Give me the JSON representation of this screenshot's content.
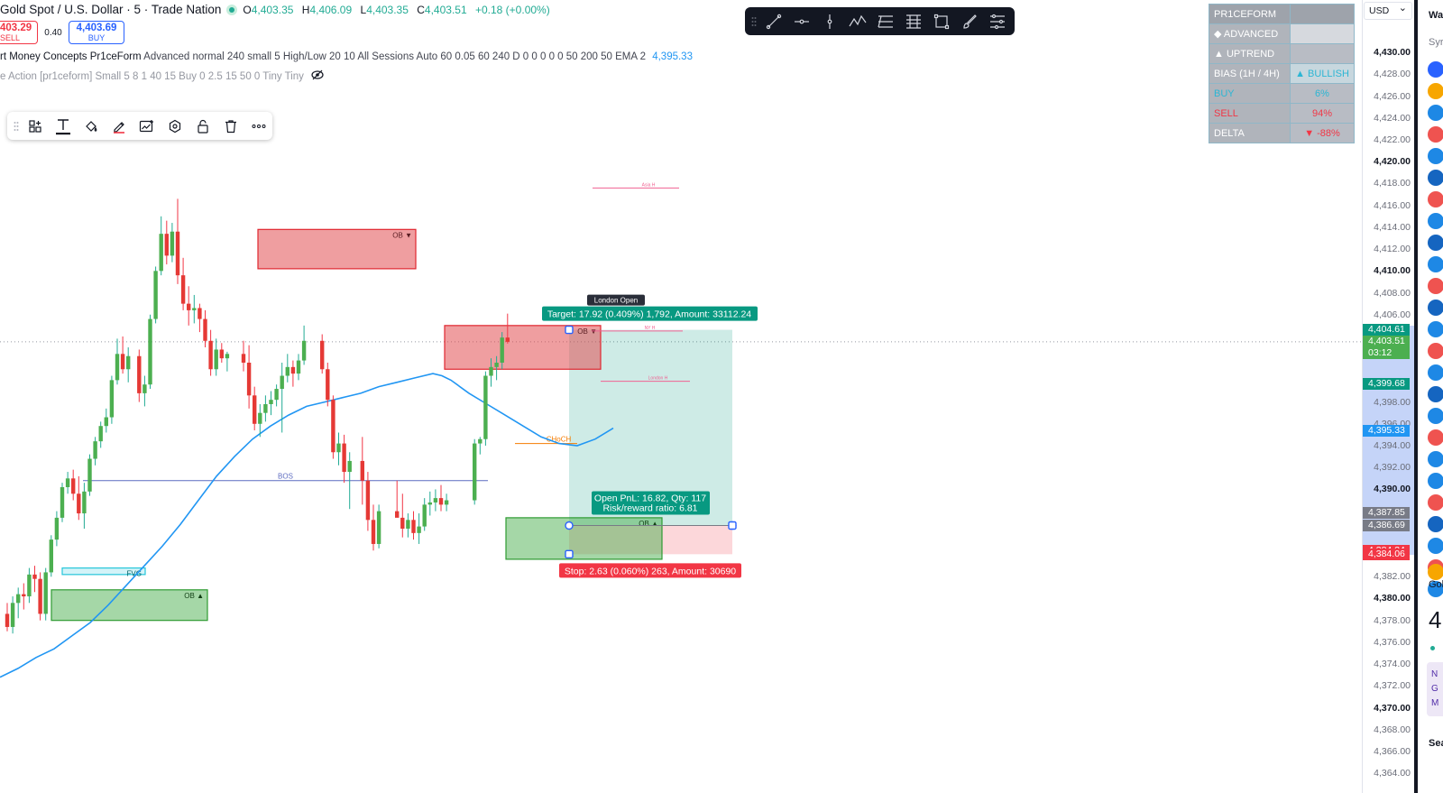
{
  "header": {
    "symbol_title": "Gold Spot / U.S. Dollar · 5 · Trade Nation",
    "ohlc": {
      "o_label": "O",
      "o": "4,403.35",
      "h_label": "H",
      "h": "4,406.09",
      "l_label": "L",
      "l": "4,403.35",
      "c_label": "C",
      "c": "4,403.51",
      "change": "+0.18 (+0.00%)"
    },
    "sell_price": "403.29",
    "sell_label": "SELL",
    "spread": "0.40",
    "buy_price": "4,403.69",
    "buy_label": "BUY"
  },
  "indicators": {
    "smc_name": "rt Money Concepts Pr1ceForm",
    "smc_params": "Advanced normal 240 small 5 High/Low 20 10 All Sessions Auto 60 0.05 60 240 D 0 0 0 0 0 50 200 50 EMA 2",
    "smc_value": "4,395.33",
    "pa_text": "e Action [pr1ceform] Small 5 8 1 40 15 Buy 0 2.5 15 50 0 Tiny Tiny"
  },
  "toolbars": {
    "drawing_toolbar_icons": [
      "grip-icon",
      "layout-icon",
      "text-tool-icon",
      "paint-bucket-icon",
      "pen-color-icon",
      "add-chart-icon",
      "settings-hex-icon",
      "lock-icon",
      "trash-icon",
      "more-icon"
    ],
    "top_toolbar_icons": [
      "grip-icon",
      "trendline-icon",
      "horizontal-ray-icon",
      "vertical-line-icon",
      "pattern-icon",
      "fib-retracement-icon",
      "fib-channel-icon",
      "rectangle-icon",
      "brush-icon",
      "more-lines-icon"
    ]
  },
  "smc_table": {
    "rows": [
      {
        "key": "PR1CEFORM",
        "value": "",
        "key_color": "#ffffff",
        "value_color": "#ffffff",
        "key_bg": "#9ea3ab",
        "value_bg": "#9ea3ab"
      },
      {
        "key": "◆ ADVANCED",
        "value": "",
        "key_color": "#ffffff",
        "value_color": "#ffffff",
        "key_bg": "#b0b4bb",
        "value_bg": "#d6d9de"
      },
      {
        "key": "▲ UPTREND",
        "value": "",
        "key_color": "#ffffff",
        "value_color": "#ffffff",
        "key_bg": "#b0b4bb",
        "value_bg": "#b8bcc4"
      },
      {
        "key": "BIAS  (1H / 4H)",
        "value": "▲ BULLISH",
        "key_color": "#ffffff",
        "value_color": "#2cb6d4",
        "key_bg": "#b0b4bb",
        "value_bg": "#c7d7de"
      },
      {
        "key": "BUY",
        "value": "6%",
        "key_color": "#2cb6d4",
        "value_color": "#2cb6d4",
        "key_bg": "#b0b4bb",
        "value_bg": "#b8bcc4"
      },
      {
        "key": "SELL",
        "value": "94%",
        "key_color": "#f23645",
        "value_color": "#f23645",
        "key_bg": "#b0b4bb",
        "value_bg": "#b8bcc4"
      },
      {
        "key": "DELTA",
        "value": "▼ -88%",
        "key_color": "#ffffff",
        "value_color": "#f23645",
        "key_bg": "#b0b4bb",
        "value_bg": "#b8bcc4"
      }
    ]
  },
  "price_axis": {
    "currency": "USD",
    "ticks": [
      {
        "label": "4,430.00",
        "y": 4430,
        "bold": true
      },
      {
        "label": "4,428.00",
        "y": 4428
      },
      {
        "label": "4,426.00",
        "y": 4426
      },
      {
        "label": "4,424.00",
        "y": 4424
      },
      {
        "label": "4,422.00",
        "y": 4422
      },
      {
        "label": "4,420.00",
        "y": 4420,
        "bold": true
      },
      {
        "label": "4,418.00",
        "y": 4418
      },
      {
        "label": "4,416.00",
        "y": 4416
      },
      {
        "label": "4,414.00",
        "y": 4414
      },
      {
        "label": "4,412.00",
        "y": 4412
      },
      {
        "label": "4,410.00",
        "y": 4410,
        "bold": true
      },
      {
        "label": "4,408.00",
        "y": 4408
      },
      {
        "label": "4,406.00",
        "y": 4406
      },
      {
        "label": "4,398.00",
        "y": 4398
      },
      {
        "label": "4,396.00",
        "y": 4396
      },
      {
        "label": "4,394.00",
        "y": 4394
      },
      {
        "label": "4,392.00",
        "y": 4392
      },
      {
        "label": "4,390.00",
        "y": 4390,
        "bold": true
      },
      {
        "label": "4,382.00",
        "y": 4382
      },
      {
        "label": "4,380.00",
        "y": 4380,
        "bold": true
      },
      {
        "label": "4,378.00",
        "y": 4378
      },
      {
        "label": "4,376.00",
        "y": 4376
      },
      {
        "label": "4,374.00",
        "y": 4374
      },
      {
        "label": "4,372.00",
        "y": 4372
      },
      {
        "label": "4,370.00",
        "y": 4370,
        "bold": true
      },
      {
        "label": "4,368.00",
        "y": 4368
      },
      {
        "label": "4,366.00",
        "y": 4366
      },
      {
        "label": "4,364.00",
        "y": 4364
      }
    ],
    "tags": [
      {
        "label": "4,404.61",
        "y": 4404.61,
        "color": "#089981"
      },
      {
        "label": "4,403.51",
        "y": 4403.51,
        "color": "#4caf50",
        "sub": "03:12"
      },
      {
        "label": "4,399.68",
        "y": 4399.68,
        "color": "#089981"
      },
      {
        "label": "4,395.33",
        "y": 4395.33,
        "color": "#2196f3"
      },
      {
        "label": "4,387.85",
        "y": 4387.85,
        "color": "#787b86"
      },
      {
        "label": "4,386.69",
        "y": 4386.69,
        "color": "#787b86"
      },
      {
        "label": "4,384.34",
        "y": 4384.34,
        "color": "#f23645"
      },
      {
        "label": "4,384.06",
        "y": 4384.06,
        "color": "#f23645"
      }
    ],
    "highlight_range": [
      4384,
      4405
    ]
  },
  "chart_data": {
    "type": "candlestick",
    "ylim": [
      4363.6,
      4432.0
    ],
    "x_index_range": [
      0,
      195
    ],
    "candles": [
      [
        4378.6,
        4379.6,
        4377.0,
        4377.4
      ],
      [
        4377.4,
        4380.2,
        4376.8,
        4379.6
      ],
      [
        4379.6,
        4381.0,
        4378.2,
        4380.4
      ],
      [
        4380.4,
        4381.4,
        4379.0,
        4380.2
      ],
      [
        4380.2,
        4382.8,
        4379.6,
        4382.2
      ],
      [
        4382.2,
        4383.0,
        4380.6,
        4381.8
      ],
      [
        4381.8,
        4382.4,
        4378.0,
        4378.6
      ],
      [
        4378.6,
        4382.8,
        4378.0,
        4382.4
      ],
      [
        4382.4,
        4385.8,
        4382.0,
        4385.4
      ],
      [
        4385.4,
        4388.0,
        4384.8,
        4387.4
      ],
      [
        4387.4,
        4390.6,
        4387.0,
        4390.2
      ],
      [
        4390.2,
        4391.6,
        4389.6,
        4391.0
      ],
      [
        4391.0,
        4391.8,
        4389.0,
        4389.6
      ],
      [
        4389.6,
        4391.2,
        4387.2,
        4387.8
      ],
      [
        4387.8,
        4390.6,
        4386.4,
        4389.8
      ],
      [
        4389.8,
        4393.2,
        4389.4,
        4392.8
      ],
      [
        4392.8,
        4394.8,
        4392.2,
        4394.4
      ],
      [
        4394.4,
        4396.2,
        4393.8,
        4395.8
      ],
      [
        4395.8,
        4397.4,
        4395.2,
        4396.6
      ],
      [
        4396.6,
        4400.4,
        4396.0,
        4400.0
      ],
      [
        4400.0,
        4403.8,
        4399.6,
        4402.4
      ],
      [
        4402.4,
        4404.0,
        4400.6,
        4401.0
      ],
      [
        4401.0,
        4403.0,
        4399.8,
        4402.2
      ],
      [
        4402.2,
        4402.8,
        4398.0,
        4398.8
      ],
      [
        4398.8,
        4400.4,
        4397.6,
        4399.6
      ],
      [
        4399.6,
        4406.0,
        4399.2,
        4405.6
      ],
      [
        4405.6,
        4410.4,
        4405.2,
        4410.0
      ],
      [
        4410.0,
        4415.0,
        4409.6,
        4413.4
      ],
      [
        4413.4,
        4414.6,
        4410.6,
        4411.4
      ],
      [
        4411.4,
        4414.4,
        4410.8,
        4413.6
      ],
      [
        4413.6,
        4416.6,
        4408.8,
        4409.6
      ],
      [
        4409.6,
        4411.2,
        4406.4,
        4407.0
      ],
      [
        4407.0,
        4408.6,
        4405.0,
        4406.4
      ],
      [
        4406.4,
        4407.8,
        4405.2,
        4406.6
      ],
      [
        4406.6,
        4407.0,
        4404.4,
        4405.6
      ],
      [
        4405.6,
        4406.4,
        4403.0,
        4403.6
      ],
      [
        4403.6,
        4404.6,
        4400.4,
        4401.0
      ],
      [
        4401.0,
        4403.8,
        4400.4,
        4402.8
      ],
      [
        4402.8,
        4403.4,
        4401.6,
        4402.0
      ],
      [
        4402.0,
        4402.6,
        4400.8,
        4402.4
      ],
      [
        4402.4,
        4403.6,
        4400.8,
        4401.6
      ],
      [
        4401.6,
        4403.2,
        4397.4,
        4398.6
      ],
      [
        4398.6,
        4399.4,
        4395.4,
        4396.0
      ],
      [
        4396.0,
        4397.8,
        4394.8,
        4397.0
      ],
      [
        4397.0,
        4398.6,
        4396.2,
        4397.8
      ],
      [
        4397.8,
        4399.0,
        4396.8,
        4398.2
      ],
      [
        4398.2,
        4399.6,
        4397.6,
        4399.2
      ],
      [
        4399.2,
        4401.6,
        4395.2,
        4400.4
      ],
      [
        4400.4,
        4402.4,
        4399.8,
        4401.2
      ],
      [
        4401.2,
        4401.8,
        4399.4,
        4400.6
      ],
      [
        4400.6,
        4402.4,
        4400.0,
        4401.8
      ],
      [
        4401.8,
        4405.0,
        4401.4,
        4403.6
      ],
      [
        4403.6,
        4404.2,
        4400.6,
        4401.0
      ],
      [
        4401.0,
        4401.6,
        4397.6,
        4398.2
      ],
      [
        4398.2,
        4398.6,
        4392.8,
        4393.4
      ],
      [
        4393.4,
        4395.2,
        4392.2,
        4394.2
      ],
      [
        4394.2,
        4395.0,
        4390.6,
        4391.6
      ],
      [
        4391.6,
        4393.4,
        4388.2,
        4392.6
      ],
      [
        4392.6,
        4394.8,
        4388.6,
        4390.8
      ],
      [
        4390.8,
        4391.6,
        4386.2,
        4387.2
      ],
      [
        4387.2,
        4388.6,
        4384.4,
        4385.0
      ],
      [
        4385.0,
        4388.6,
        4384.6,
        4388.0
      ],
      [
        4388.0,
        4390.8,
        4387.6,
        4387.4
      ],
      [
        4387.4,
        4389.6,
        4385.6,
        4386.4
      ],
      [
        4386.4,
        4387.8,
        4385.6,
        4387.2
      ],
      [
        4387.2,
        4388.0,
        4385.4,
        4386.0
      ],
      [
        4386.0,
        4387.8,
        4385.0,
        4386.6
      ],
      [
        4386.6,
        4389.2,
        4386.2,
        4388.6
      ],
      [
        4388.6,
        4389.8,
        4387.6,
        4388.8
      ],
      [
        4388.8,
        4390.0,
        4388.0,
        4389.2
      ],
      [
        4389.2,
        4390.4,
        4388.0,
        4388.6
      ],
      [
        4388.6,
        4389.6,
        4388.0,
        4389.0
      ],
      [
        4389.0,
        4394.6,
        4388.6,
        4394.2
      ],
      [
        4394.2,
        4394.8,
        4393.2,
        4394.6
      ],
      [
        4394.6,
        4400.8,
        4394.0,
        4400.4
      ],
      [
        4400.4,
        4402.0,
        4399.4,
        4401.2
      ],
      [
        4401.2,
        4402.2,
        4400.0,
        4401.6
      ],
      [
        4401.6,
        4404.4,
        4401.0,
        4403.9
      ],
      [
        4403.9,
        4406.09,
        4403.35,
        4403.51
      ]
    ],
    "candle_x_start": 8,
    "candle_x_step": 6.1,
    "candle_x_offsets": [
      [
        0,
        0
      ],
      [
        23,
        6
      ],
      [
        40,
        18
      ],
      [
        52,
        32
      ],
      [
        58,
        40
      ],
      [
        62,
        54
      ],
      [
        72,
        79
      ]
    ],
    "ema_x": [
      0,
      20,
      40,
      60,
      80,
      100,
      120,
      140,
      160,
      180,
      200,
      220,
      240,
      260,
      280,
      300,
      320,
      340,
      360,
      380,
      400,
      420,
      440,
      460,
      480,
      490,
      500,
      520,
      540,
      560,
      580,
      600,
      620,
      640,
      660,
      680
    ],
    "ema_y": [
      4372.8,
      4373.6,
      4374.6,
      4375.4,
      4376.6,
      4377.8,
      4379.4,
      4381.2,
      4383.0,
      4384.8,
      4386.8,
      4389.0,
      4391.2,
      4393.0,
      4394.6,
      4395.8,
      4396.8,
      4397.6,
      4398.0,
      4398.4,
      4398.8,
      4399.4,
      4399.8,
      4400.2,
      4400.6,
      4400.4,
      4400.0,
      4398.8,
      4397.8,
      4396.8,
      4395.8,
      4394.8,
      4394.2,
      4394.0,
      4394.6,
      4395.6
    ],
    "zones": [
      {
        "name": "ob-bearish-high",
        "label": "OB ▼",
        "x0": 286,
        "x1": 461,
        "y0": 4413.8,
        "y1": 4410.2,
        "kind": "bear"
      },
      {
        "name": "ob-bearish-mid",
        "label": "OB ▼",
        "x0": 493,
        "x1": 666,
        "y0": 4405.0,
        "y1": 4401.0,
        "kind": "bear"
      },
      {
        "name": "ob-bullish-low",
        "label": "OB ▲",
        "x0": 57,
        "x1": 230,
        "y0": 4380.8,
        "y1": 4378.0,
        "kind": "bull"
      },
      {
        "name": "ob-bullish-recent",
        "label": "OB ▲",
        "x0": 561,
        "x1": 734,
        "y0": 4387.4,
        "y1": 4383.6,
        "kind": "bull"
      },
      {
        "name": "fvg-zone",
        "label": "FVG",
        "x0": 69,
        "x1": 161,
        "y0": 4382.8,
        "y1": 4382.2,
        "kind": "fvg"
      }
    ],
    "lines": [
      {
        "name": "bos-line",
        "label": "BOS",
        "x0": 92,
        "x1": 541,
        "y": 4390.8,
        "color": "#5c6bc0"
      },
      {
        "name": "choch-line",
        "label": "CHoCH",
        "x0": 571,
        "x1": 640,
        "y": 4394.2,
        "color": "#f57c00"
      },
      {
        "name": "asia-high-line",
        "label": "Asia H",
        "x0": 657,
        "x1": 753,
        "y": 4417.6,
        "color": "#f06292"
      },
      {
        "name": "ny-high-line",
        "label": "NY H",
        "x0": 656,
        "x1": 757,
        "y": 4404.5,
        "color": "#f06292"
      },
      {
        "name": "london-high-line",
        "label": "London H",
        "x0": 666,
        "x1": 765,
        "y": 4399.9,
        "color": "#f06292"
      }
    ],
    "position": {
      "entry": 4386.69,
      "target": 4404.61,
      "stop": 4384.06,
      "x0": 631,
      "x1": 812,
      "target_label": "Target: 17.92 (0.409%) 1,792, Amount: 33112.24",
      "stop_label": "Stop: 2.63 (0.060%) 263, Amount: 30690",
      "pnl_label": "Open PnL: 16.82, Qty: 117",
      "rr_label": "Risk/reward ratio: 6.81"
    },
    "session_label": "London Open",
    "last_price": 4403.51
  },
  "right_panel": {
    "top_text": "Wa",
    "sym_text": "Syr",
    "gold_text": "Gol",
    "big_num": "4",
    "letters": [
      "N",
      "G",
      "M"
    ],
    "sea_text": "Sea"
  }
}
